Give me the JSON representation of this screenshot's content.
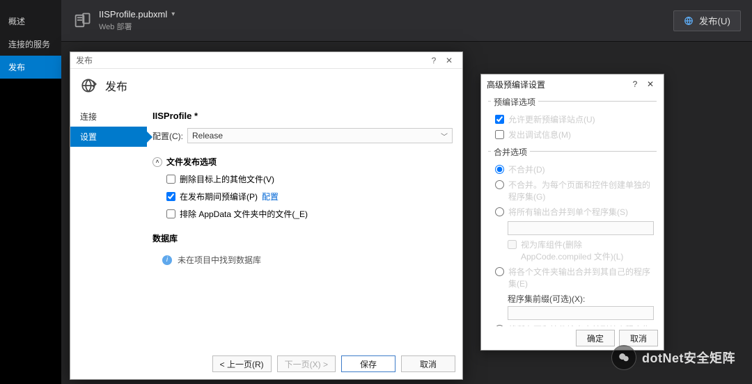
{
  "sidebar": {
    "items": [
      {
        "label": "概述"
      },
      {
        "label": "连接的服务"
      },
      {
        "label": "发布"
      }
    ],
    "active_index": 2
  },
  "header": {
    "profile": "IISProfile.pubxml",
    "meta": "Web 部署",
    "publish_button": "发布(U)"
  },
  "publish_dialog": {
    "title": "发布",
    "header_title": "发布",
    "side": {
      "items": [
        {
          "label": "连接"
        },
        {
          "label": "设置"
        }
      ],
      "active_index": 1
    },
    "profile_label": "IISProfile *",
    "config_label": "配置(C):",
    "config_value": "Release",
    "sections": {
      "publish_options_title": "文件发布选项",
      "publish_options": [
        {
          "label": "删除目标上的其他文件(V)",
          "checked": false
        },
        {
          "label": "在发布期间预编译(P)",
          "checked": true,
          "link": "配置"
        },
        {
          "label": "排除 AppData 文件夹中的文件(_E)",
          "checked": false
        }
      ],
      "database_title": "数据库",
      "database_empty": "未在项目中找到数据库"
    },
    "footer": {
      "prev": "< 上一页(R)",
      "next": "下一页(X) >",
      "save": "保存",
      "cancel": "取消"
    }
  },
  "advanced_dialog": {
    "title": "高级预编译设置",
    "group_precompile_title": "预编译选项",
    "precompile": [
      {
        "label": "允许更新预编译站点(U)",
        "checked": true
      },
      {
        "label": "发出调试信息(M)",
        "checked": false
      }
    ],
    "group_merge_title": "合并选项",
    "merge_options": [
      {
        "label": "不合并(D)"
      },
      {
        "label": "不合并。为每个页面和控件创建单独的程序集(G)"
      },
      {
        "label": "将所有输出合并到单个程序集(S)"
      },
      {
        "label": "将各个文件夹输出合并到其自己的程序集(E)"
      },
      {
        "label": "将所有页和控件输出合并到单个程序集(N)"
      }
    ],
    "merge_selected_index": 0,
    "treat_as_lib_label": "视为库组件(删除 AppCode.compiled 文件)(L)",
    "assembly_prefix_label": "程序集前缀(可选)(X):",
    "footer": {
      "ok": "确定",
      "cancel": "取消"
    }
  },
  "watermark": "dotNet安全矩阵"
}
